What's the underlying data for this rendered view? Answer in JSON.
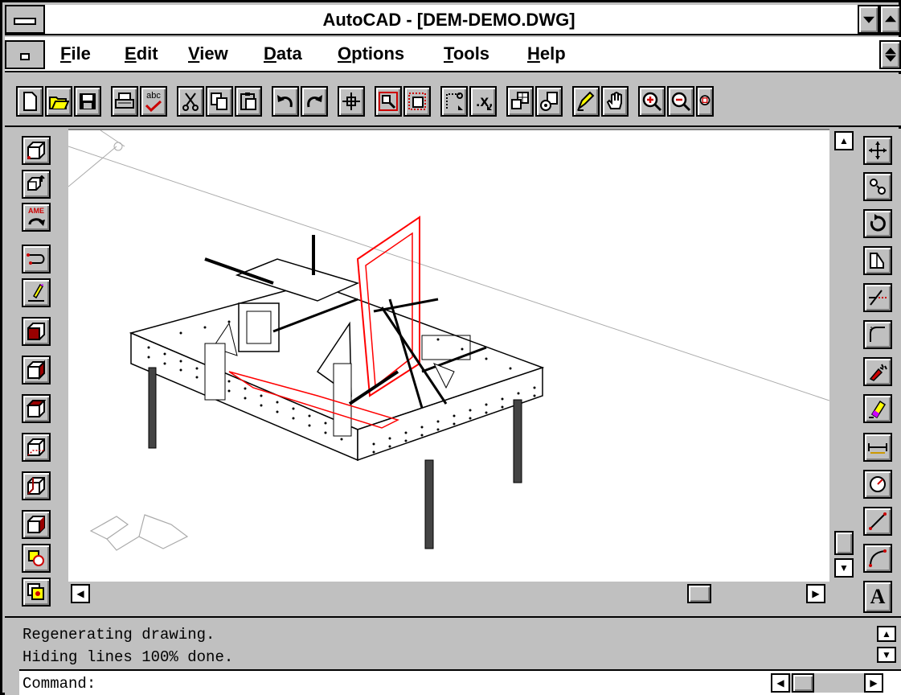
{
  "window": {
    "title": "AutoCAD - [DEM-DEMO.DWG]"
  },
  "menu": {
    "items": [
      {
        "label": "File"
      },
      {
        "label": "Edit"
      },
      {
        "label": "View"
      },
      {
        "label": "Data"
      },
      {
        "label": "Options"
      },
      {
        "label": "Tools"
      },
      {
        "label": "Help"
      }
    ]
  },
  "toolbar": {
    "buttons": [
      "new-icon",
      "open-icon",
      "save-icon",
      "print-icon",
      "spell-check-icon",
      "cut-icon",
      "copy-icon",
      "paste-icon",
      "undo-icon",
      "redo-icon",
      "snap-icon",
      "zoom-window-icon",
      "named-views-icon",
      "point-icon",
      "ucs-icon",
      "insert-block-icon",
      "external-reference-icon",
      "pencil-icon",
      "pan-hand-icon",
      "zoom-in-icon",
      "zoom-out-icon",
      "zoom-all-icon"
    ],
    "spell_label": "abc"
  },
  "left_tools": [
    "box-icon",
    "solid-edit-icon",
    "ame-icon",
    "polyline-icon",
    "draw-icon",
    "view-front-icon",
    "view-right-icon",
    "view-top-icon",
    "view-iso-sw-icon",
    "view-iso-se-icon",
    "view-iso-ne-icon",
    "hide-icon",
    "render-icon"
  ],
  "left_tool_ame_label": "AME",
  "right_tools": [
    "move-icon",
    "copy-object-icon",
    "rotate-icon",
    "mirror-icon",
    "trim-icon",
    "fillet-icon",
    "explode-icon",
    "erase-icon",
    "dimension-linear-icon",
    "dimension-radius-icon",
    "dimension-aligned-icon",
    "dimension-angular-icon",
    "text-icon"
  ],
  "right_tool_text_label": "A",
  "command": {
    "lines": [
      "Regenerating drawing.",
      "Hiding lines 100% done."
    ],
    "prompt": "Command:"
  },
  "colors": {
    "window_bg": "#c0c0c0",
    "drawing_bg": "#ffffff",
    "highlight_red": "#ff0000"
  }
}
